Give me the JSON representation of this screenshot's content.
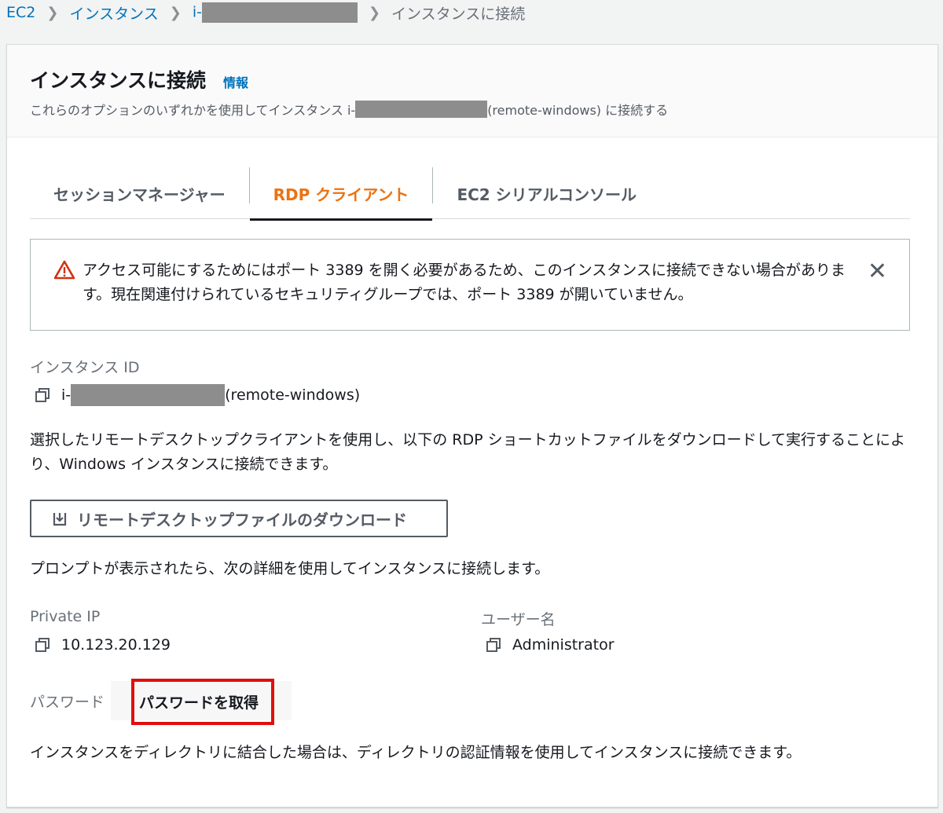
{
  "breadcrumb": {
    "ec2": "EC2",
    "instances": "インスタンス",
    "instance_prefix": "i-",
    "current": "インスタンスに接続"
  },
  "header": {
    "title": "インスタンスに接続",
    "info": "情報",
    "desc_before": "これらのオプションのいずれかを使用してインスタンス i-",
    "desc_after": "(remote-windows) に接続する"
  },
  "tabs": [
    {
      "label": "セッションマネージャー",
      "active": false
    },
    {
      "label": "RDP クライアント",
      "active": true
    },
    {
      "label": "EC2 シリアルコンソール",
      "active": false
    }
  ],
  "alert": {
    "text": "アクセス可能にするためにはポート 3389 を開く必要があるため、このインスタンスに接続できない場合があります。現在関連付けられているセキュリティグループでは、ポート 3389 が開いていません。"
  },
  "instance": {
    "label": "インスタンス ID",
    "id_prefix": "i-",
    "name": "(remote-windows)"
  },
  "rdp": {
    "description": "選択したリモートデスクトップクライアントを使用し、以下の RDP ショートカットファイルをダウンロードして実行することにより、Windows インスタンスに接続できます。",
    "download_label": "リモートデスクトップファイルのダウンロード",
    "prompt_text": "プロンプトが表示されたら、次の詳細を使用してインスタンスに接続します。"
  },
  "details": {
    "private_ip_label": "Private IP",
    "private_ip": "10.123.20.129",
    "username_label": "ユーザー名",
    "username": "Administrator",
    "password_label": "パスワード",
    "get_password": "パスワードを取得"
  },
  "footer_text": "インスタンスをディレクトリに結合した場合は、ディレクトリの認証情報を使用してインスタンスに接続できます。",
  "colors": {
    "link": "#0073bb",
    "active_tab": "#ec7211",
    "warning": "#d13212",
    "highlight_box": "#e10e0e"
  },
  "icons": [
    "chevron-right-icon",
    "warning-icon",
    "close-icon",
    "copy-icon",
    "download-icon"
  ]
}
